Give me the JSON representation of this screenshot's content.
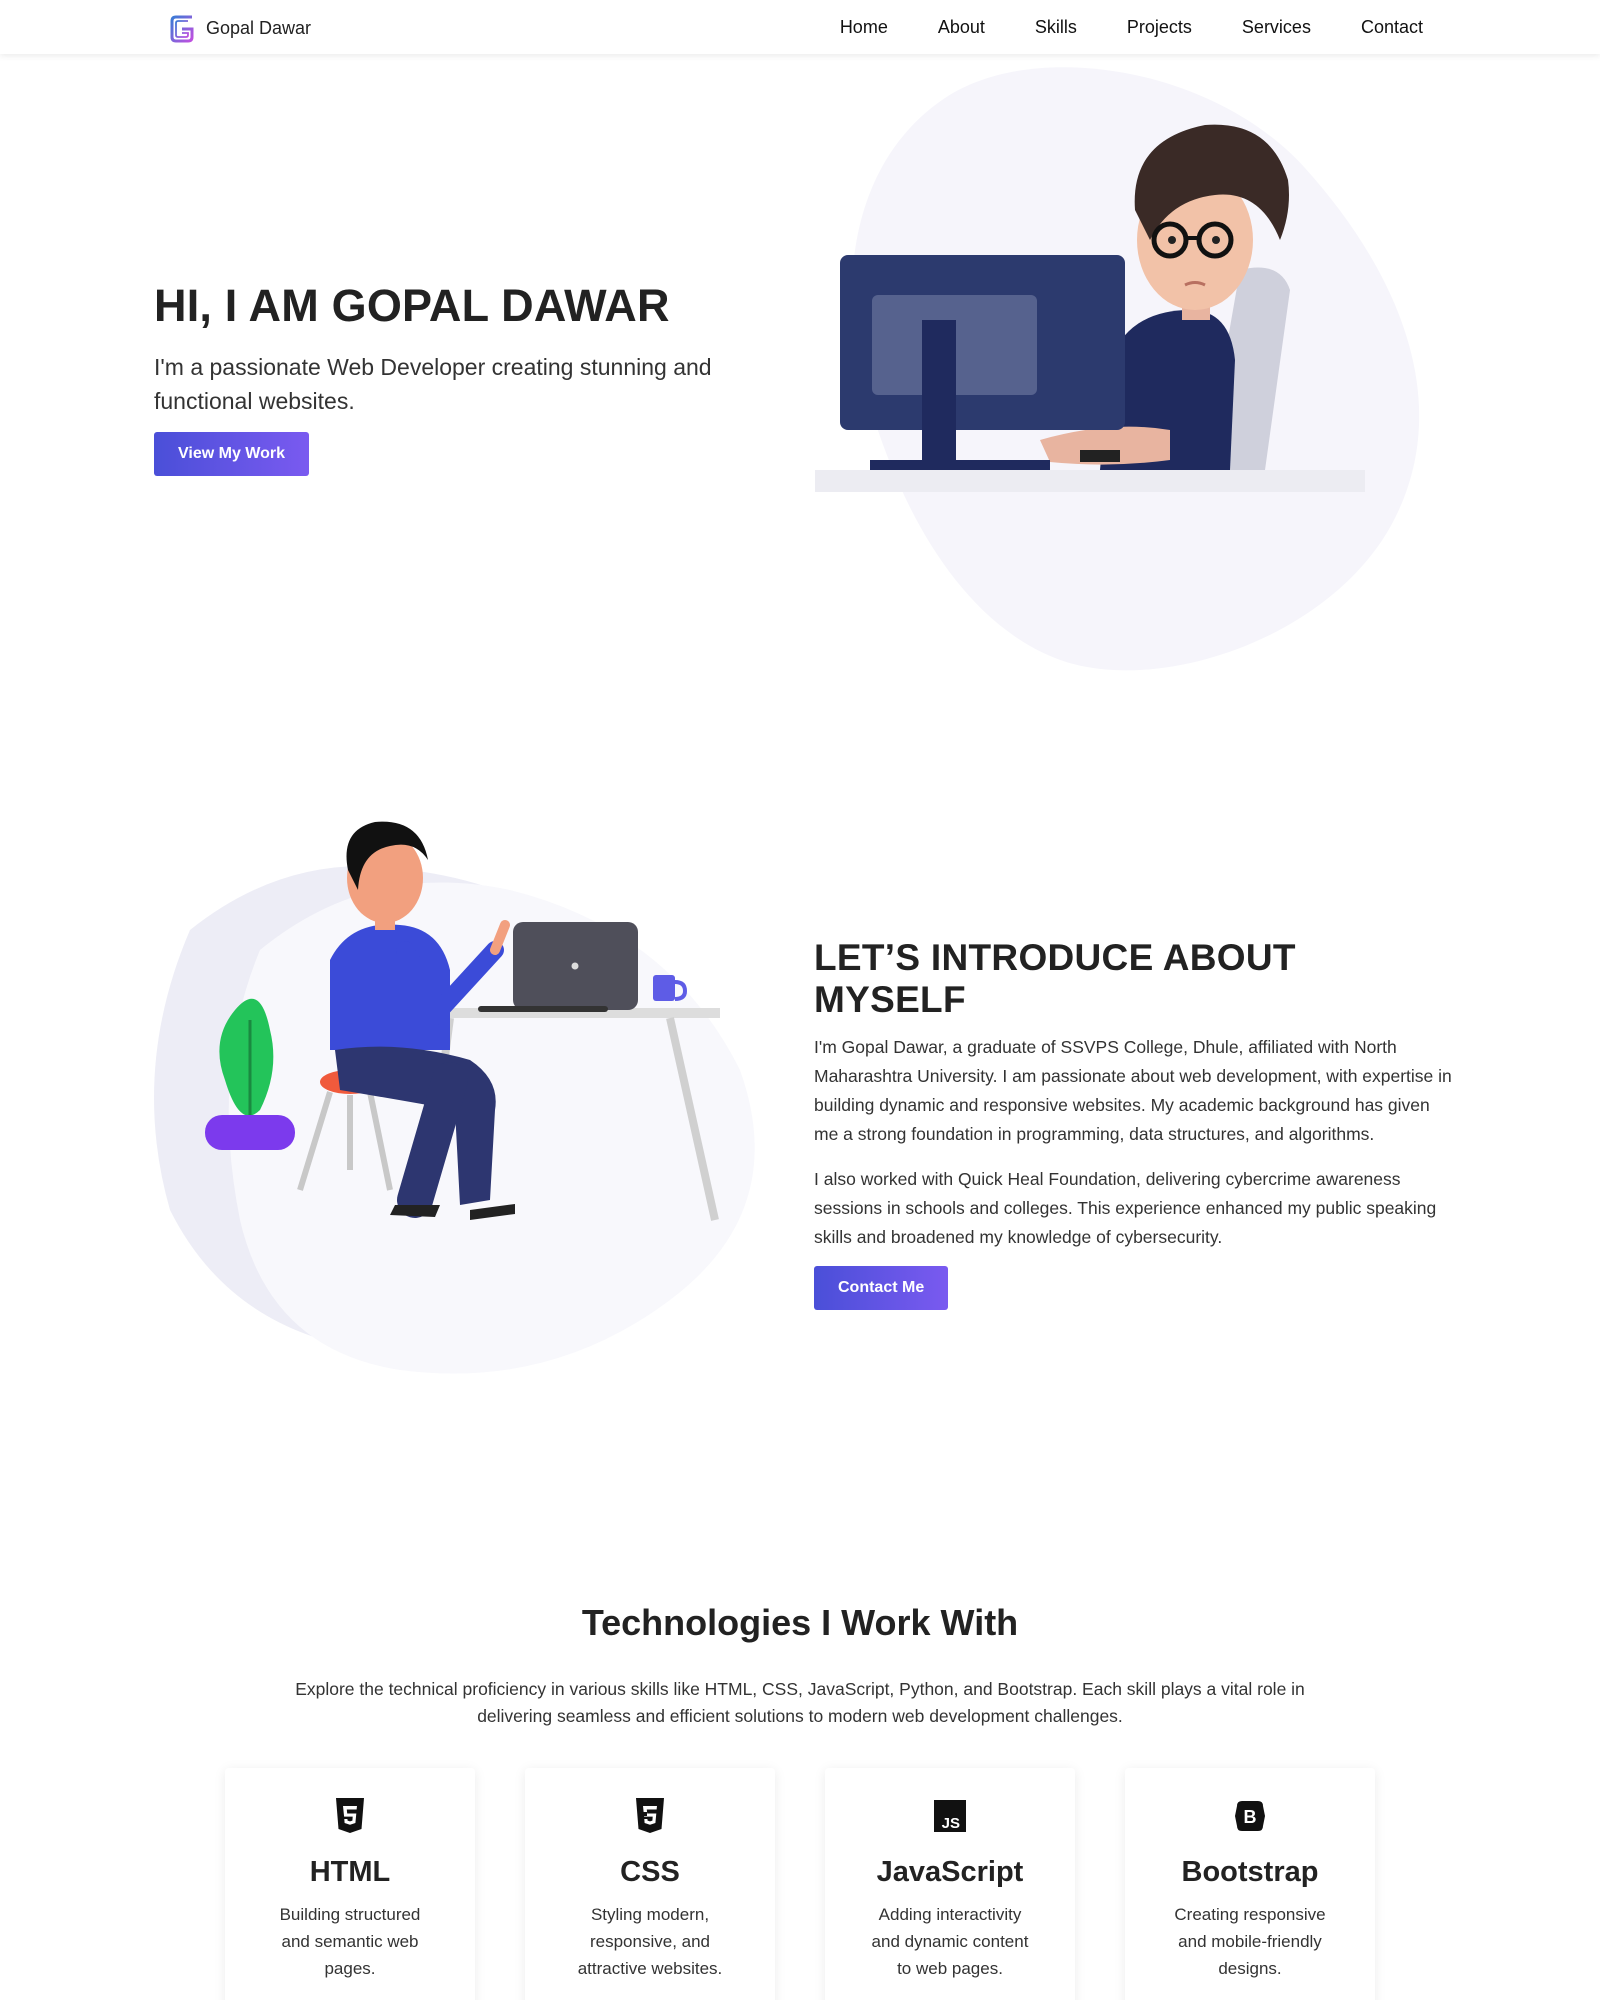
{
  "nav": {
    "brand_name": "Gopal Dawar",
    "logo_icon": "g-monogram-logo",
    "items": [
      {
        "label": "Home"
      },
      {
        "label": "About"
      },
      {
        "label": "Skills"
      },
      {
        "label": "Projects"
      },
      {
        "label": "Services"
      },
      {
        "label": "Contact"
      }
    ]
  },
  "hero": {
    "title": "HI, I AM GOPAL DAWAR",
    "subtitle": "I'm a passionate Web Developer creating stunning and functional websites.",
    "button_label": "View My Work"
  },
  "about": {
    "title": "LET’S INTRODUCE ABOUT MYSELF",
    "paragraph_1": "I'm Gopal Dawar, a graduate of SSVPS College, Dhule, affiliated with North Maharashtra University. I am passionate about web development, with expertise in building dynamic and responsive websites. My academic background has given me a strong foundation in programming, data structures, and algorithms.",
    "paragraph_2": "I also worked with Quick Heal Foundation, delivering cybercrime awareness sessions in schools and colleges. This experience enhanced my public speaking skills and broadened my knowledge of cybersecurity.",
    "button_label": "Contact Me"
  },
  "tech": {
    "title": "Technologies I Work With",
    "description": "Explore the technical proficiency in various skills like HTML, CSS, JavaScript, Python, and Bootstrap. Each skill plays a vital role in delivering seamless and efficient solutions to modern web development challenges.",
    "cards": [
      {
        "icon": "html5-icon",
        "title": "HTML",
        "desc": "Building structured and semantic web pages."
      },
      {
        "icon": "css3-icon",
        "title": "CSS",
        "desc": "Styling modern, responsive, and attractive websites."
      },
      {
        "icon": "javascript-icon",
        "title": "JavaScript",
        "desc": "Adding interactivity and dynamic content to web pages."
      },
      {
        "icon": "bootstrap-icon",
        "title": "Bootstrap",
        "desc": "Creating responsive and mobile-friendly designs."
      }
    ]
  },
  "colors": {
    "accent_start": "#4a4fd8",
    "accent_end": "#7a5af0",
    "blob": "#f6f5fb"
  }
}
